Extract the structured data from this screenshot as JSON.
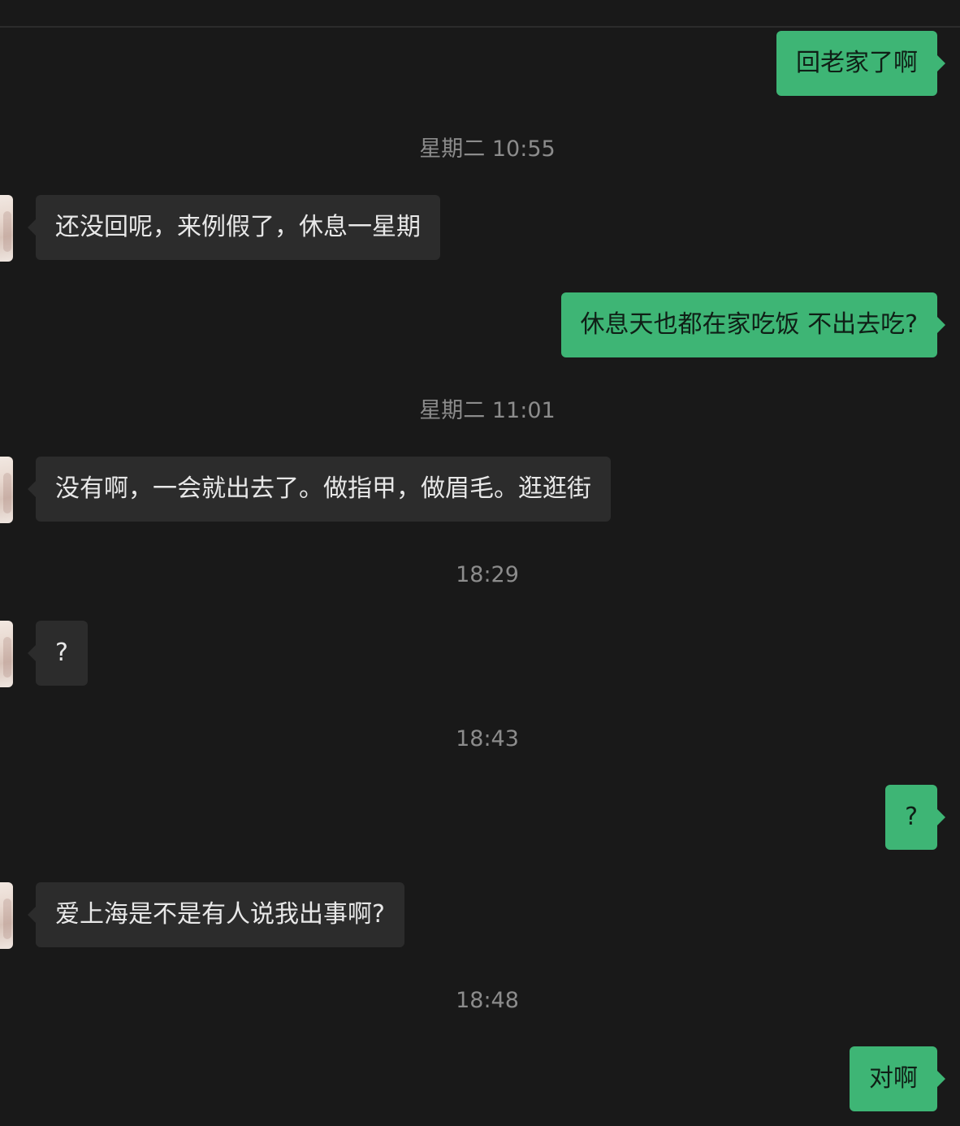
{
  "colors": {
    "background": "#191919",
    "incoming_bubble": "#2c2c2c",
    "outgoing_bubble": "#3eb575",
    "timestamp_text": "#8c8c8c"
  },
  "messages": [
    {
      "type": "outgoing",
      "text": "回老家了啊"
    },
    {
      "type": "timestamp",
      "text": "星期二 10:55"
    },
    {
      "type": "incoming",
      "text": "还没回呢，来例假了，休息一星期"
    },
    {
      "type": "outgoing",
      "text": "休息天也都在家吃饭 不出去吃?"
    },
    {
      "type": "timestamp",
      "text": "星期二 11:01"
    },
    {
      "type": "incoming",
      "text": "没有啊，一会就出去了。做指甲，做眉毛。逛逛街"
    },
    {
      "type": "timestamp",
      "text": "18:29"
    },
    {
      "type": "incoming",
      "text": "?"
    },
    {
      "type": "timestamp",
      "text": "18:43"
    },
    {
      "type": "outgoing",
      "text": "?"
    },
    {
      "type": "incoming",
      "text": "爱上海是不是有人说我出事啊?"
    },
    {
      "type": "timestamp",
      "text": "18:48"
    },
    {
      "type": "outgoing",
      "text": "对啊"
    }
  ]
}
